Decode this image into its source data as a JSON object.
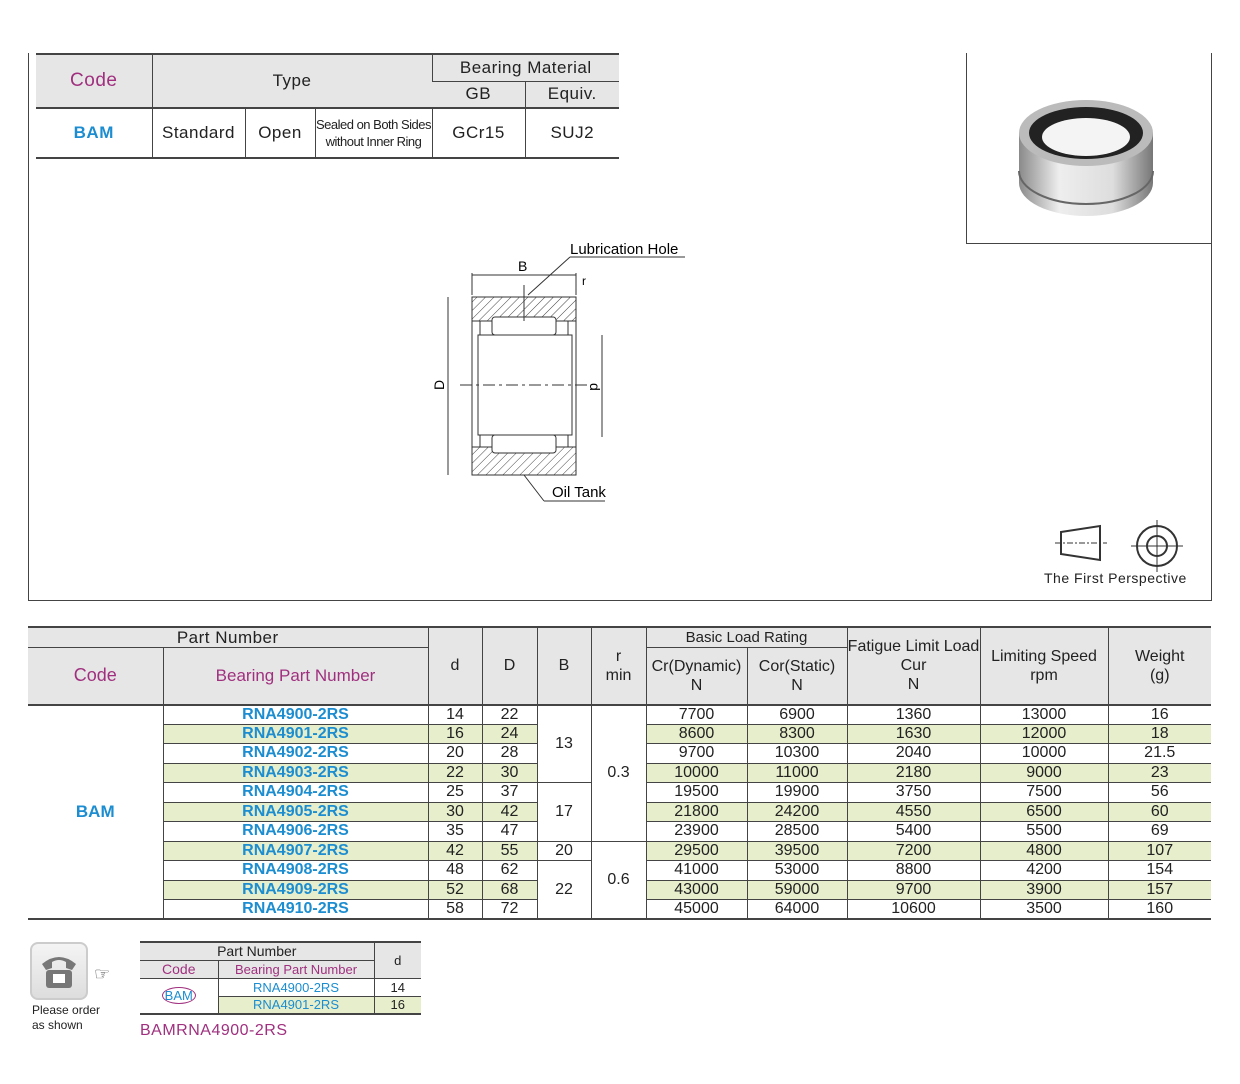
{
  "type_table": {
    "code_header": "Code",
    "type_header": "Type",
    "material_header": "Bearing Material",
    "gb_header": "GB",
    "equiv_header": "Equiv.",
    "code": "BAM",
    "standard": "Standard",
    "open": "Open",
    "sealed_line1": "Sealed on Both Sides",
    "sealed_line2": "without Inner Ring",
    "gb": "GCr15",
    "equiv": "SUJ2"
  },
  "drawing": {
    "lubrication_hole": "Lubrication Hole",
    "oil_tank": "Oil Tank",
    "B": "B",
    "r": "r",
    "D": "D",
    "d": "d"
  },
  "projection": {
    "label": "The First Perspective"
  },
  "main_table": {
    "part_number": "Part Number",
    "code": "Code",
    "bearing_part_number": "Bearing Part Number",
    "d": "d",
    "D": "D",
    "B": "B",
    "r_line1": "r",
    "r_line2": "min",
    "basic_load_rating": "Basic Load Rating",
    "cr": "Cr(Dynamic)",
    "cor": "Cor(Static)",
    "unit_n": "N",
    "fatigue": "Fatigue Limit Load",
    "cur": "Cur",
    "speed": "Limiting Speed",
    "rpm": "rpm",
    "weight": "Weight",
    "grams": "(g)",
    "code_value": "BAM",
    "B_groups": [
      "13",
      "17",
      "20",
      "22"
    ],
    "r_groups": [
      "0.3",
      "0.6"
    ],
    "rows": [
      {
        "pn": "RNA4900-2RS",
        "d": "14",
        "D": "22",
        "cr": "7700",
        "cor": "6900",
        "cur": "1360",
        "speed": "13000",
        "weight": "16"
      },
      {
        "pn": "RNA4901-2RS",
        "d": "16",
        "D": "24",
        "cr": "8600",
        "cor": "8300",
        "cur": "1630",
        "speed": "12000",
        "weight": "18"
      },
      {
        "pn": "RNA4902-2RS",
        "d": "20",
        "D": "28",
        "cr": "9700",
        "cor": "10300",
        "cur": "2040",
        "speed": "10000",
        "weight": "21.5"
      },
      {
        "pn": "RNA4903-2RS",
        "d": "22",
        "D": "30",
        "cr": "10000",
        "cor": "11000",
        "cur": "2180",
        "speed": "9000",
        "weight": "23"
      },
      {
        "pn": "RNA4904-2RS",
        "d": "25",
        "D": "37",
        "cr": "19500",
        "cor": "19900",
        "cur": "3750",
        "speed": "7500",
        "weight": "56"
      },
      {
        "pn": "RNA4905-2RS",
        "d": "30",
        "D": "42",
        "cr": "21800",
        "cor": "24200",
        "cur": "4550",
        "speed": "6500",
        "weight": "60"
      },
      {
        "pn": "RNA4906-2RS",
        "d": "35",
        "D": "47",
        "cr": "23900",
        "cor": "28500",
        "cur": "5400",
        "speed": "5500",
        "weight": "69"
      },
      {
        "pn": "RNA4907-2RS",
        "d": "42",
        "D": "55",
        "cr": "29500",
        "cor": "39500",
        "cur": "7200",
        "speed": "4800",
        "weight": "107"
      },
      {
        "pn": "RNA4908-2RS",
        "d": "48",
        "D": "62",
        "cr": "41000",
        "cor": "53000",
        "cur": "8800",
        "speed": "4200",
        "weight": "154"
      },
      {
        "pn": "RNA4909-2RS",
        "d": "52",
        "D": "68",
        "cr": "43000",
        "cor": "59000",
        "cur": "9700",
        "speed": "3900",
        "weight": "157"
      },
      {
        "pn": "RNA4910-2RS",
        "d": "58",
        "D": "72",
        "cr": "45000",
        "cor": "64000",
        "cur": "10600",
        "speed": "3500",
        "weight": "160"
      }
    ]
  },
  "order_example": {
    "note": "Please order as shown",
    "part_number": "Part Number",
    "code": "Code",
    "bearing_part_number": "Bearing Part Number",
    "d": "d",
    "code_value": "BAM",
    "rows": [
      {
        "pn": "RNA4900-2RS",
        "d": "14"
      },
      {
        "pn": "RNA4901-2RS",
        "d": "16"
      }
    ],
    "result": "BAMRNA4900-2RS"
  }
}
